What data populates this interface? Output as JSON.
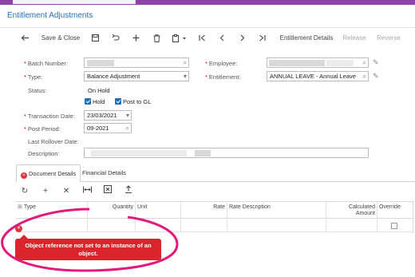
{
  "title": "Entitlement Adjustments",
  "toolbar": {
    "save_close": "Save & Close",
    "entitlement_details": "Entitlement Details",
    "release": "Release",
    "reverse": "Reverse"
  },
  "form": {
    "batch_number_label": "Batch Number:",
    "type_label": "Type:",
    "type_value": "Balance Adjustment",
    "status_label": "Status:",
    "status_value": "On Hold",
    "hold_label": "Hold",
    "post_gl_label": "Post to GL",
    "transaction_date_label": "Transaction Date:",
    "transaction_date_value": "23/03/2021",
    "post_period_label": "Post Period:",
    "post_period_value": "09-2021",
    "last_rollover_label": "Last Rollover Date:",
    "description_label": "Description:",
    "employee_label": "Employee:",
    "entitlement_label": "Entitlement:",
    "entitlement_value": "ANNUAL LEAVE - Annual Leave"
  },
  "tabs": {
    "document_details": "Document Details",
    "financial_details": "Financial Details"
  },
  "grid": {
    "columns": {
      "type": "Type",
      "quantity": "Quantity",
      "unit": "Unit",
      "rate": "Rate",
      "rate_description": "Rate Description",
      "calculated_amount_1": "Calculated",
      "calculated_amount_2": "Amount",
      "override": "Override"
    }
  },
  "error": {
    "row_marker": "×",
    "message_line1": "Object reference not set to an instance of an",
    "message_line2": "object."
  },
  "colors": {
    "accent": "#8d44a8",
    "link": "#1f6fbf",
    "error": "#d9252b",
    "annotation": "#e5197a"
  }
}
